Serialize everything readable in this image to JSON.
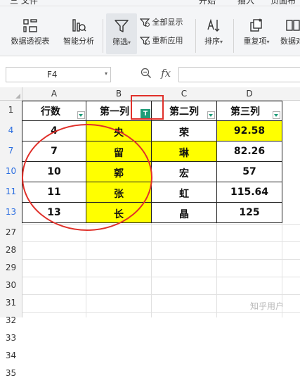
{
  "menubar": {
    "items": [
      "三 文件",
      "开始",
      "插入",
      "页面布"
    ]
  },
  "ribbon": {
    "buttons": [
      {
        "label": "数据透视表",
        "icon": "pivot-table-icon"
      },
      {
        "label": "智能分析",
        "icon": "smart-analysis-icon"
      },
      {
        "label": "筛选",
        "icon": "filter-icon"
      },
      {
        "label": "全部显示",
        "icon": "show-all-icon"
      },
      {
        "label": "重新应用",
        "icon": "reapply-icon"
      },
      {
        "label": "排序",
        "icon": "sort-icon"
      },
      {
        "label": "重复项",
        "icon": "duplicates-icon"
      },
      {
        "label": "数据对",
        "icon": "data-compare-icon"
      }
    ]
  },
  "formula_bar": {
    "cell_ref": "F4",
    "fx": "fx",
    "value": ""
  },
  "columns": [
    "A",
    "B",
    "C",
    "D"
  ],
  "header_row": {
    "row_number": "1",
    "cells": [
      "行数",
      "第一列",
      "第二列",
      "第三列"
    ]
  },
  "data_rows": [
    {
      "row_number": "4",
      "cells": [
        "4",
        "央",
        "荣",
        "92.58"
      ],
      "yellow": [
        false,
        true,
        false,
        true
      ]
    },
    {
      "row_number": "7",
      "cells": [
        "7",
        "留",
        "琳",
        "82.26"
      ],
      "yellow": [
        false,
        true,
        true,
        false
      ]
    },
    {
      "row_number": "10",
      "cells": [
        "10",
        "郭",
        "宏",
        "57"
      ],
      "yellow": [
        false,
        true,
        false,
        false
      ]
    },
    {
      "row_number": "11",
      "cells": [
        "11",
        "张",
        "虹",
        "115.64"
      ],
      "yellow": [
        false,
        true,
        false,
        false
      ]
    },
    {
      "row_number": "13",
      "cells": [
        "13",
        "长",
        "晶",
        "125"
      ],
      "yellow": [
        false,
        true,
        false,
        false
      ]
    }
  ],
  "empty_rows": [
    "27",
    "28",
    "29",
    "30",
    "31",
    "32",
    "33",
    "34",
    "35"
  ],
  "watermark": "知乎用户",
  "colors": {
    "highlight": "#ffff00",
    "annotation": "#e0302a",
    "filter_green": "#1d9c78"
  }
}
